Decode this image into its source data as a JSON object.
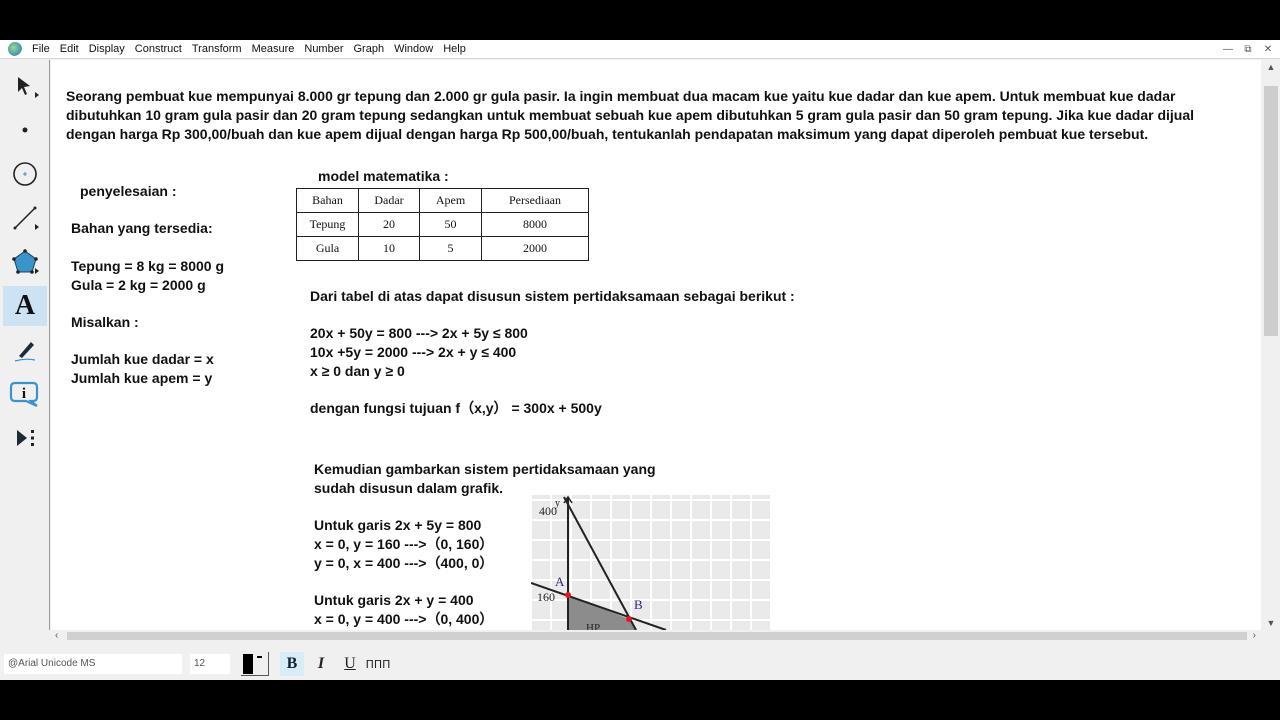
{
  "menubar": {
    "items": [
      "File",
      "Edit",
      "Display",
      "Construct",
      "Transform",
      "Measure",
      "Number",
      "Graph",
      "Window",
      "Help"
    ],
    "window_controls": [
      "minimize",
      "restore",
      "close"
    ]
  },
  "toolbox": {
    "tools": [
      {
        "name": "arrow-tool",
        "label": "Selection Arrow"
      },
      {
        "name": "point-tool",
        "label": "Point"
      },
      {
        "name": "compass-tool",
        "label": "Compass"
      },
      {
        "name": "straightedge-tool",
        "label": "Straightedge"
      },
      {
        "name": "polygon-tool",
        "label": "Polygon"
      },
      {
        "name": "text-tool",
        "label": "A",
        "active": true
      },
      {
        "name": "marker-tool",
        "label": "Marker"
      },
      {
        "name": "information-tool",
        "label": "i"
      },
      {
        "name": "custom-tool",
        "label": "Custom Tools"
      }
    ]
  },
  "document": {
    "problem": "Seorang pembuat kue mempunyai 8.000 gr tepung dan 2.000 gr gula pasir. Ia ingin membuat dua macam kue yaitu kue dadar dan kue apem. Untuk membuat kue dadar dibutuhkan 10 gram gula pasir dan 20 gram tepung sedangkan untuk membuat sebuah kue apem dibutuhkan 5 gram gula pasir dan 50 gram tepung. Jika kue dadar dijual dengan harga Rp 300,00/buah dan kue apem dijual dengan harga Rp 500,00/buah, tentukanlah pendapatan maksimum yang dapat diperoleh pembuat kue tersebut.",
    "left_column": {
      "heading": "penyelesaian :",
      "bahan_title": "Bahan yang tersedia:",
      "tepung": "Tepung = 8 kg = 8000 g",
      "gula": "Gula = 2 kg = 2000 g",
      "misalkan": "Misalkan :",
      "var_x": "Jumlah kue dadar = x",
      "var_y": "Jumlah kue apem = y"
    },
    "model": {
      "title": "model matematika :",
      "headers": [
        "Bahan",
        "Dadar",
        "Apem",
        "Persediaan"
      ],
      "rows": [
        [
          "Tepung",
          "20",
          "50",
          "8000"
        ],
        [
          "Gula",
          "10",
          "5",
          "2000"
        ]
      ]
    },
    "system": {
      "intro": "Dari tabel di atas dapat disusun sistem pertidaksamaan sebagai berikut :",
      "eq1": "20x + 50y = 800 ---> 2x + 5y ≤ 800",
      "eq2": "10x +5y = 2000 ---> 2x + y ≤ 400",
      "eq3": "x ≥ 0 dan y ≥ 0",
      "objective": "dengan fungsi tujuan f（x,y） = 300x + 500y"
    },
    "graph_section": {
      "intro_line1": "Kemudian gambarkan sistem pertidaksamaan yang",
      "intro_line2": "sudah disusun dalam grafik.",
      "line1_title": "Untuk garis 2x + 5y = 800",
      "line1_p1": "x = 0, y = 160 --->（0, 160）",
      "line1_p2": "y = 0, x = 400 --->（400, 0）",
      "line2_title": "Untuk garis 2x + y = 400",
      "line2_p1": "x = 0, y = 400 --->（0, 400）"
    },
    "graph": {
      "y_axis_label": "y",
      "tick_400": "400",
      "tick_160": "160",
      "point_a": "A",
      "point_b": "B",
      "region_label": "HP",
      "point_color": "#e8141e",
      "label_color": "#2a2a8c",
      "region_color": "#8c8c8c"
    }
  },
  "text_toolbar": {
    "font": "@Arial Unicode MS",
    "size": "12",
    "color": "#000000",
    "bold": "B",
    "italic": "I",
    "underline": "U",
    "math_format": "ΠΠΠ"
  }
}
